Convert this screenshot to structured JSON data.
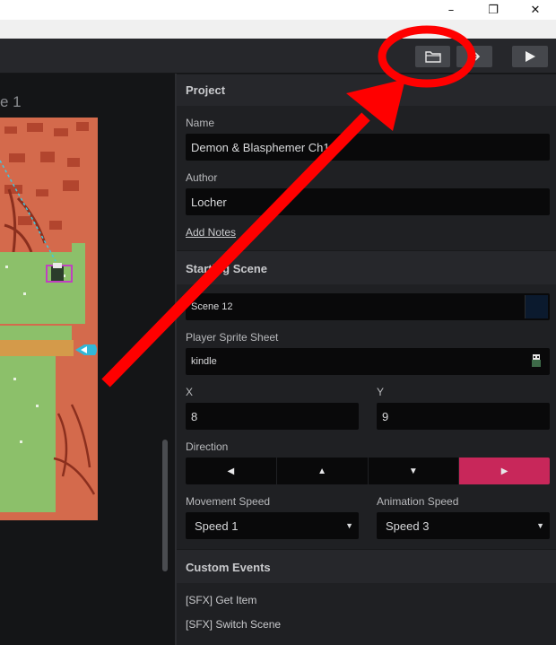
{
  "window": {
    "minimize_glyph": "–",
    "restore_glyph": "❐",
    "close_glyph": "✕"
  },
  "toolbar": {
    "open_folder_icon": "folder-open-icon",
    "export_icon": "export-icon",
    "play_icon": "play-icon"
  },
  "canvas": {
    "scene_label": "e 1"
  },
  "project": {
    "header": "Project",
    "name_label": "Name",
    "name_value": "Demon & Blasphemer Ch1",
    "author_label": "Author",
    "author_value": "Locher",
    "add_notes": "Add Notes"
  },
  "starting_scene": {
    "header": "Starting Scene",
    "scene_value": "Scene 12",
    "sprite_label": "Player Sprite Sheet",
    "sprite_value": "kindle",
    "x_label": "X",
    "x_value": "8",
    "y_label": "Y",
    "y_value": "9",
    "direction_label": "Direction",
    "directions": [
      "◀",
      "▲",
      "▼",
      "▶"
    ],
    "direction_selected": "right",
    "movement_speed_label": "Movement Speed",
    "movement_speed_value": "Speed 1",
    "animation_speed_label": "Animation Speed",
    "animation_speed_value": "Speed 3",
    "select_arrow": "▼"
  },
  "custom_events": {
    "header": "Custom Events",
    "items": [
      "[SFX] Get Item",
      "[SFX] Switch Scene"
    ]
  },
  "colors": {
    "accent": "#c8275a",
    "annotation_red": "#ff0000",
    "map_rock": "#d46a4c",
    "map_grass": "#8cc06a"
  }
}
